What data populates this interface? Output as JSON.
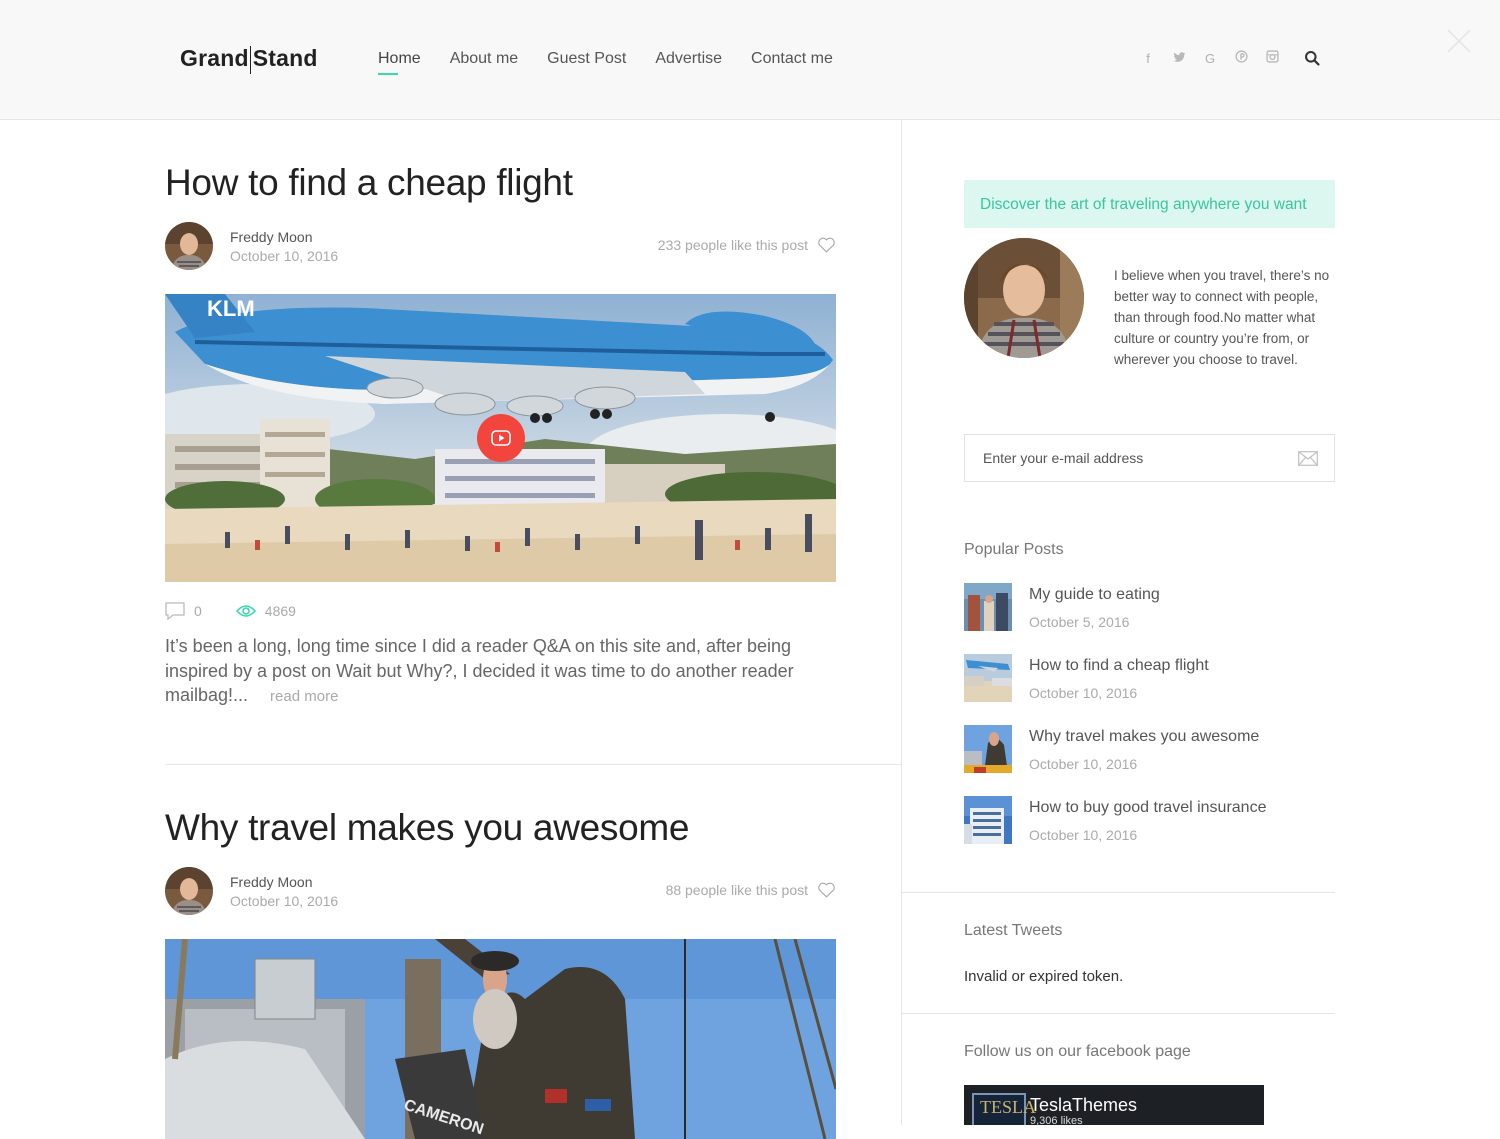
{
  "brand": {
    "part1": "Grand",
    "part2": "Stand"
  },
  "nav": [
    {
      "label": "Home",
      "active": true
    },
    {
      "label": "About me"
    },
    {
      "label": "Guest Post"
    },
    {
      "label": "Advertise"
    },
    {
      "label": "Contact me"
    }
  ],
  "social_icons": [
    "facebook-icon",
    "twitter-icon",
    "google-icon",
    "pinterest-icon",
    "instagram-icon"
  ],
  "social_glyphs": {
    "facebook": "f",
    "twitter": "t",
    "google": "G",
    "pinterest": "p",
    "instagram": "◻"
  },
  "posts": [
    {
      "title": "How to find a cheap flight",
      "author": "Freddy Moon",
      "date": "October 10, 2016",
      "likes": "233 people like this post",
      "comments": "0",
      "views": "4869",
      "excerpt": "It’s been a long, long time since I did a reader Q&A on this site and, after being inspired by a post on Wait but Why?, I decided it was time to do another reader mailbag!...",
      "read_more": "read more",
      "image_brand": "KLM"
    },
    {
      "title": "Why travel makes you awesome",
      "author": "Freddy Moon",
      "date": "October 10, 2016",
      "likes": "88 people like this post",
      "image_text": "CAMERON"
    }
  ],
  "sidebar": {
    "banner": "Discover the art of traveling anywhere you want",
    "about": "I believe when you travel, there’s no better way to connect with people, than through food.No matter what culture or country you’re from, or wherever you choose to travel.",
    "email_placeholder": "Enter your e-mail address",
    "popular_title": "Popular Posts",
    "popular": [
      {
        "title": "My guide to eating",
        "date": "October 5, 2016"
      },
      {
        "title": "How to find a cheap flight",
        "date": "October 10, 2016"
      },
      {
        "title": "Why travel makes you awesome",
        "date": "October 10, 2016"
      },
      {
        "title": "How to buy good travel insurance",
        "date": "October 10, 2016"
      }
    ],
    "tweets_title": "Latest Tweets",
    "tweets_message": "Invalid or expired token.",
    "facebook_title": "Follow us on our facebook page",
    "facebook": {
      "name": "TeslaThemes",
      "likes": "9,306 likes",
      "logo_text": "TESLA"
    }
  },
  "colors": {
    "accent": "#3ad7b0",
    "banner_bg": "#dbf7ef",
    "banner_text": "#3ac59f",
    "play": "#f1453d"
  }
}
